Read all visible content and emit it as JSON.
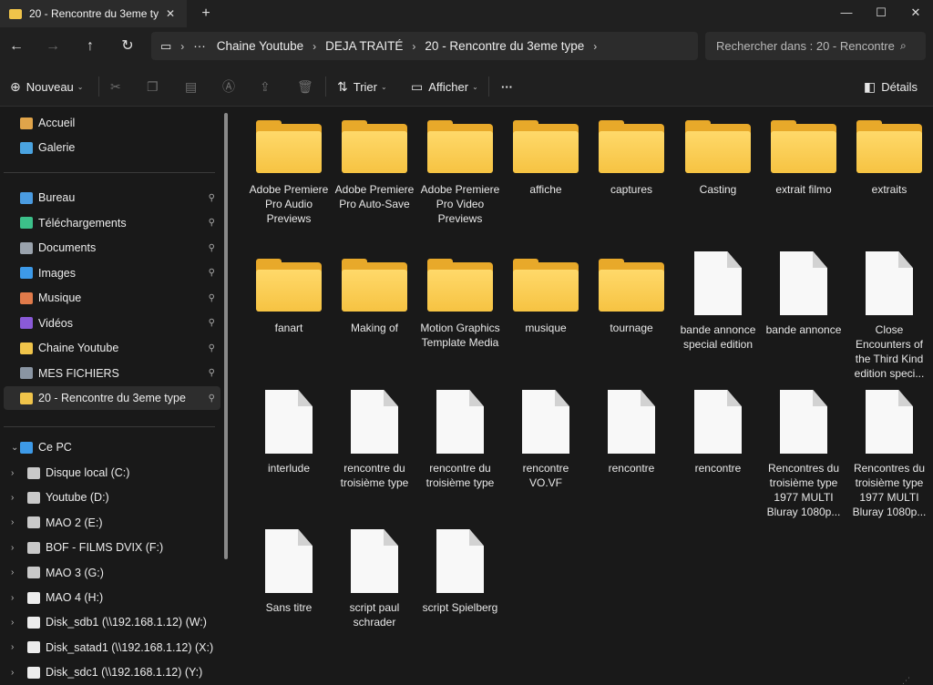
{
  "window": {
    "tab_title": "20 - Rencontre du 3eme ty",
    "tab_close": "✕",
    "new_tab": "+",
    "minimize": "—",
    "maximize": "☐",
    "close": "✕"
  },
  "nav": {
    "back": "←",
    "forward": "→",
    "up": "↑",
    "refresh": "↻"
  },
  "address": {
    "computer_icon": "▭",
    "overflow": "···",
    "crumbs": [
      "Chaine Youtube",
      "DEJA TRAITÉ",
      "20 - Rencontre du 3eme type"
    ],
    "sep": "›"
  },
  "search": {
    "placeholder": "Rechercher dans : 20 - Rencontre",
    "icon": "⌕"
  },
  "toolbar": {
    "new_label": "Nouveau",
    "sort_label": "Trier",
    "view_label": "Afficher",
    "more_label": "···",
    "details_label": "Détails"
  },
  "sidebar": {
    "top": [
      {
        "label": "Accueil",
        "icon": "home-icon",
        "color": "#e0a44a"
      },
      {
        "label": "Galerie",
        "icon": "gallery-icon",
        "color": "#4aa3e0"
      }
    ],
    "quick": [
      {
        "label": "Bureau",
        "icon": "desktop-icon",
        "color": "#4a9be0"
      },
      {
        "label": "Téléchargements",
        "icon": "download-icon",
        "color": "#3cc08a"
      },
      {
        "label": "Documents",
        "icon": "documents-icon",
        "color": "#9aa3ad"
      },
      {
        "label": "Images",
        "icon": "images-icon",
        "color": "#3d9ae8"
      },
      {
        "label": "Musique",
        "icon": "music-icon",
        "color": "#e07a4a"
      },
      {
        "label": "Vidéos",
        "icon": "videos-icon",
        "color": "#8a5ad8"
      },
      {
        "label": "Chaine Youtube",
        "icon": "folder-icon",
        "color": "#f0c44a"
      },
      {
        "label": "MES FICHIERS",
        "icon": "network-folder-icon",
        "color": "#8a95a3"
      },
      {
        "label": "20 - Rencontre du 3eme type",
        "icon": "folder-icon",
        "color": "#f0c44a"
      }
    ],
    "pc_label": "Ce PC",
    "drives": [
      {
        "label": "Disque local (C:)",
        "icon": "drive-icon"
      },
      {
        "label": "Youtube (D:)",
        "icon": "drive-icon"
      },
      {
        "label": "MAO 2 (E:)",
        "icon": "drive-icon"
      },
      {
        "label": "BOF - FILMS DVIX (F:)",
        "icon": "drive-icon"
      },
      {
        "label": "MAO 3 (G:)",
        "icon": "drive-icon"
      },
      {
        "label": "MAO 4 (H:)",
        "icon": "file-icon"
      },
      {
        "label": "Disk_sdb1 (\\\\192.168.1.12) (W:)",
        "icon": "file-icon"
      },
      {
        "label": "Disk_satad1 (\\\\192.168.1.12) (X:)",
        "icon": "file-icon"
      },
      {
        "label": "Disk_sdc1 (\\\\192.168.1.12) (Y:)",
        "icon": "file-icon"
      }
    ],
    "pin": "📌",
    "expand": "›",
    "expand_open": "⌄"
  },
  "files": [
    {
      "name": "Adobe Premiere Pro Audio Previews",
      "type": "folder"
    },
    {
      "name": "Adobe Premiere Pro Auto-Save",
      "type": "folder"
    },
    {
      "name": "Adobe Premiere Pro Video Previews",
      "type": "folder"
    },
    {
      "name": "affiche",
      "type": "folder"
    },
    {
      "name": "captures",
      "type": "folder"
    },
    {
      "name": "Casting",
      "type": "folder"
    },
    {
      "name": "extrait filmo",
      "type": "folder"
    },
    {
      "name": "extraits",
      "type": "folder"
    },
    {
      "name": "fanart",
      "type": "folder"
    },
    {
      "name": "Making of",
      "type": "folder"
    },
    {
      "name": "Motion Graphics Template Media",
      "type": "folder"
    },
    {
      "name": "musique",
      "type": "folder"
    },
    {
      "name": "tournage",
      "type": "folder"
    },
    {
      "name": "bande annonce special edition",
      "type": "file"
    },
    {
      "name": "bande annonce",
      "type": "file"
    },
    {
      "name": "Close Encounters of the Third Kind edition speci...",
      "type": "file"
    },
    {
      "name": "interlude",
      "type": "file"
    },
    {
      "name": "rencontre du troisième type",
      "type": "file"
    },
    {
      "name": "rencontre du troisième type",
      "type": "file"
    },
    {
      "name": "rencontre VO.VF",
      "type": "file"
    },
    {
      "name": "rencontre",
      "type": "file"
    },
    {
      "name": "rencontre",
      "type": "file"
    },
    {
      "name": "Rencontres du troisième type 1977 MULTI Bluray 1080p...",
      "type": "file"
    },
    {
      "name": "Rencontres du troisième type 1977 MULTI Bluray 1080p...",
      "type": "file"
    },
    {
      "name": "Sans titre",
      "type": "file"
    },
    {
      "name": "script paul schrader",
      "type": "file"
    },
    {
      "name": "script Spielberg",
      "type": "file"
    }
  ]
}
